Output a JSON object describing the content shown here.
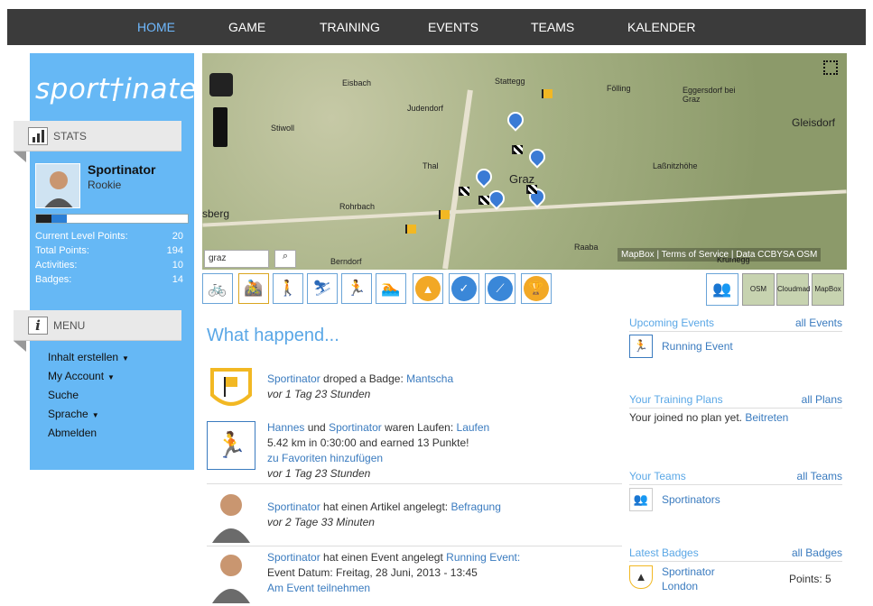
{
  "nav": {
    "home": "HOME",
    "game": "GAME",
    "training": "TRAINING",
    "events": "EVENTS",
    "teams": "TEAMS",
    "kalender": "KALENDER"
  },
  "logo": "sport†inate",
  "stats": {
    "title": "STATS",
    "user": "Sportinator",
    "rank": "Rookie",
    "level_pct": 0.2,
    "rows": [
      {
        "label": "Current Level Points:",
        "value": "20"
      },
      {
        "label": "Total Points:",
        "value": "194"
      },
      {
        "label": "Activities:",
        "value": "10"
      },
      {
        "label": "Badges:",
        "value": "14"
      }
    ]
  },
  "menu": {
    "title": "MENU",
    "items": [
      "Inhalt erstellen",
      "My Account",
      "Suche",
      "Sprache",
      "Abmelden"
    ]
  },
  "map": {
    "places": [
      "Eisbach",
      "Stattegg",
      "Judendorf",
      "Fölling",
      "Eggersdorf bei Graz",
      "Gleisdorf",
      "Stiwoll",
      "Thal",
      "Graz",
      "Laßnitzhöhe",
      "Rohrbach",
      "sberg",
      "Raaba",
      "Berndorf",
      "Krumegg"
    ],
    "search": "graz",
    "attribution": "MapBox | Terms of Service | Data CCBYSA OSM",
    "layers": [
      "OSM",
      "Cloudmad",
      "MapBox"
    ]
  },
  "toolbar": [
    "bike",
    "mountainbike",
    "walking",
    "skiing",
    "running",
    "swimming",
    "badge",
    "check",
    "nordic",
    "trophy"
  ],
  "feed": {
    "title": "What happend...",
    "entries": [
      {
        "user": "Sportinator",
        "text": " droped a Badge: ",
        "target": "Mantscha",
        "line2": "",
        "time": "vor 1 Tag 23 Stunden"
      },
      {
        "user": "Hannes",
        "text": " und ",
        "user2": "Sportinator",
        "text2": " waren Laufen: ",
        "target": "Laufen",
        "line2": "5.42 km in 0:30:00 and earned 13 Punkte!",
        "link": "zu Favoriten hinzufügen",
        "time": "vor 1 Tag 23 Stunden"
      },
      {
        "user": "Sportinator",
        "text": " hat einen Artikel angelegt: ",
        "target": "Befragung",
        "line2": "",
        "time": "vor 2 Tage 33 Minuten"
      },
      {
        "user": "Sportinator",
        "text": " hat einen Event angelegt ",
        "target": "Running Event:",
        "line2": "Event Datum: Freitag, 28 Juni, 2013 - 13:45",
        "link": "Am Event teilnehmen",
        "time": ""
      }
    ]
  },
  "right": {
    "upcoming": {
      "title": "Upcoming Events",
      "link": "all Events",
      "item": "Running Event"
    },
    "plans": {
      "title": "Your Training Plans",
      "link": "all Plans",
      "text": "Your joined no plan yet. ",
      "action": "Beitreten"
    },
    "teams": {
      "title": "Your Teams",
      "link": "all Teams",
      "item": "Sportinators"
    },
    "badges": {
      "title": "Latest Badges",
      "link": "all Badges",
      "user": "Sportinator",
      "place": "London",
      "points": "Points: 5"
    }
  }
}
